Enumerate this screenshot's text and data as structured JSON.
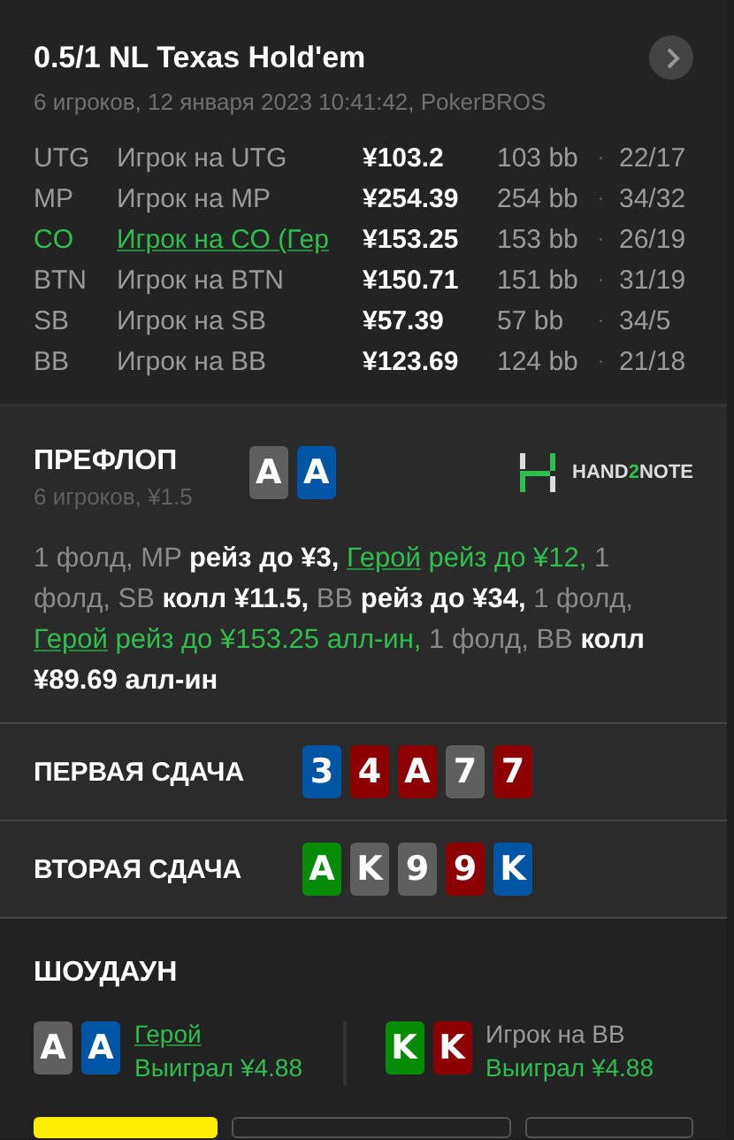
{
  "header": {
    "title": "0.5/1 NL Texas Hold'em",
    "subtitle": "6 игроков, 12 января 2023 10:41:42, PokerBROS"
  },
  "players": [
    {
      "position": "UTG",
      "name": "Игрок на UTG",
      "stack": "¥103.2",
      "bb": "103 bb",
      "separator": "·",
      "stats": "22/17",
      "hero": false
    },
    {
      "position": "MP",
      "name": "Игрок на MP",
      "stack": "¥254.39",
      "bb": "254 bb",
      "separator": "·",
      "stats": "34/32",
      "hero": false
    },
    {
      "position": "CO",
      "name": "Игрок на CO (Гер",
      "stack": "¥153.25",
      "bb": "153 bb",
      "separator": "·",
      "stats": "26/19",
      "hero": true
    },
    {
      "position": "BTN",
      "name": "Игрок на BTN",
      "stack": "¥150.71",
      "bb": "151 bb",
      "separator": "·",
      "stats": "31/19",
      "hero": false
    },
    {
      "position": "SB",
      "name": "Игрок на SB",
      "stack": "¥57.39",
      "bb": "57 bb",
      "separator": "·",
      "stats": "34/5",
      "hero": false
    },
    {
      "position": "BB",
      "name": "Игрок на BB",
      "stack": "¥123.69",
      "bb": "124 bb",
      "separator": "·",
      "stats": "21/18",
      "hero": false
    }
  ],
  "preflop": {
    "title": "ПРЕФЛОП",
    "subtitle": "6 игроков, ¥1.5",
    "cards": [
      {
        "rank": "A",
        "color": "#5f5f5f"
      },
      {
        "rank": "A",
        "color": "#0055a5"
      }
    ],
    "logo": {
      "parts": [
        {
          "text": "HAND",
          "accent": false
        },
        {
          "text": "2",
          "accent": true
        },
        {
          "text": "NOTE",
          "accent": false
        }
      ]
    },
    "actions": [
      {
        "kind": "muted",
        "text": "1 фолд, MP "
      },
      {
        "kind": "strong",
        "text": "рейз до ¥3, "
      },
      {
        "kind": "hero-link",
        "text": "Герой"
      },
      {
        "kind": "hero",
        "text": " рейз до ¥12, "
      },
      {
        "kind": "muted",
        "text": "1 фолд, SB "
      },
      {
        "kind": "strong",
        "text": "колл ¥11.5, "
      },
      {
        "kind": "muted",
        "text": "BB "
      },
      {
        "kind": "strong",
        "text": "рейз до ¥34, "
      },
      {
        "kind": "muted",
        "text": "1 фолд, "
      },
      {
        "kind": "hero-link",
        "text": "Герой"
      },
      {
        "kind": "hero",
        "text": " рейз до ¥153.25 алл-ин, "
      },
      {
        "kind": "muted",
        "text": "1 фолд, BB "
      },
      {
        "kind": "strong",
        "text": "колл ¥89.69 алл-ин"
      }
    ]
  },
  "boards": [
    {
      "title": "ПЕРВАЯ СДАЧА",
      "cards": [
        {
          "rank": "3",
          "color": "#0055a5"
        },
        {
          "rank": "4",
          "color": "#8c0000"
        },
        {
          "rank": "A",
          "color": "#8c0000"
        },
        {
          "rank": "7",
          "color": "#5f5f5f"
        },
        {
          "rank": "7",
          "color": "#8c0000"
        }
      ]
    },
    {
      "title": "ВТОРАЯ СДАЧА",
      "cards": [
        {
          "rank": "A",
          "color": "#078c07"
        },
        {
          "rank": "K",
          "color": "#5f5f5f"
        },
        {
          "rank": "9",
          "color": "#5f5f5f"
        },
        {
          "rank": "9",
          "color": "#8c0000"
        },
        {
          "rank": "K",
          "color": "#0055a5"
        }
      ]
    }
  ],
  "showdown": {
    "title": "ШОУДАУН",
    "players": [
      {
        "name": "Герой",
        "hero": true,
        "result": "Выиграл ¥4.88",
        "cards": [
          {
            "rank": "A",
            "color": "#5f5f5f"
          },
          {
            "rank": "A",
            "color": "#0055a5"
          }
        ]
      },
      {
        "name": "Игрок на BB",
        "hero": false,
        "result": "Выиграл ¥4.88",
        "cards": [
          {
            "rank": "K",
            "color": "#078c07"
          },
          {
            "rank": "K",
            "color": "#8c0000"
          }
        ]
      }
    ]
  },
  "buttons": [
    {
      "kind": "primary"
    },
    {
      "kind": "outline"
    },
    {
      "kind": "outline"
    }
  ]
}
